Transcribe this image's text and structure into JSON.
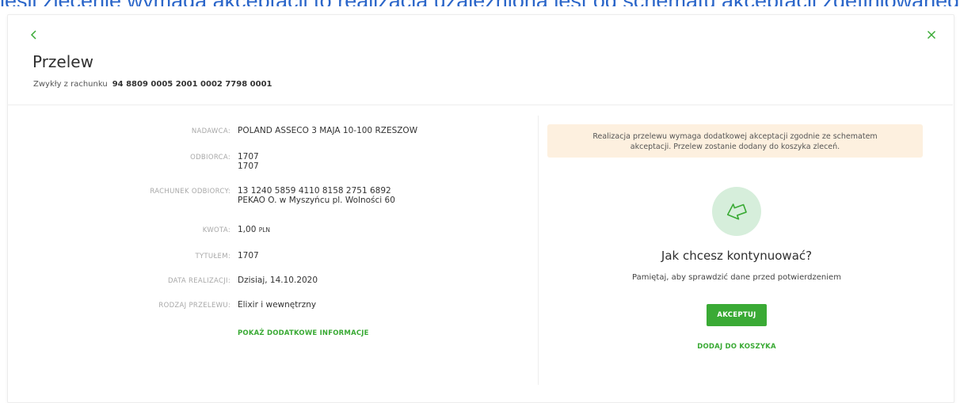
{
  "top_banner_text": "jeśli zlecenie wymaga akceptacji to realizacja uzależniona jest od schematu akceptacji zdefiniowanego dla firmy w systemie bankowym",
  "header": {
    "back_icon": "chevron-left-icon",
    "close_icon": "close-icon",
    "title": "Przelew",
    "account_prefix": "Zwykły z rachunku",
    "account_number": "94 8809 0005 2001 0002 7798 0001"
  },
  "details": {
    "rows": [
      {
        "label": "NADAWCA:",
        "lines": [
          "POLAND ASSECO 3 MAJA 10-100 RZESZOW"
        ]
      },
      {
        "label": "ODBIORCA:",
        "lines": [
          "1707",
          "1707"
        ]
      },
      {
        "label": "RACHUNEK ODBIORCY:",
        "lines": [
          "13 1240 5859 4110 8158 2751 6892",
          "PEKAO O. w Myszyńcu  pl. Wolności 60"
        ]
      },
      {
        "label": "KWOTA:",
        "amount": "1,00",
        "currency": "PLN"
      },
      {
        "label": "TYTUŁEM:",
        "lines": [
          "1707"
        ]
      },
      {
        "label": "DATA REALIZACJI:",
        "lines": [
          "Dzisiaj, 14.10.2020"
        ]
      },
      {
        "label": "RODZAJ PRZELEWU:",
        "lines": [
          "Elixir i wewnętrzny"
        ]
      }
    ],
    "more_link": "POKAŻ DODATKOWE INFORMACJE"
  },
  "action": {
    "notice_line1": "Realizacja przelewu wymaga dodatkowej akceptacji zgodnie ze schematem",
    "notice_line2": "akceptacji. Przelew zostanie dodany do koszyka zleceń.",
    "icon": "send-arrow-icon",
    "question": "Jak chcesz kontynuować?",
    "hint": "Pamiętaj, aby sprawdzić dane przed potwierdzeniem",
    "accept_label": "AKCEPTUJ",
    "basket_label": "DODAJ DO KOSZYKA"
  },
  "colors": {
    "accent": "#3aaa35",
    "notice_bg": "#fdf0df",
    "icon_bg": "#d6eedb"
  }
}
